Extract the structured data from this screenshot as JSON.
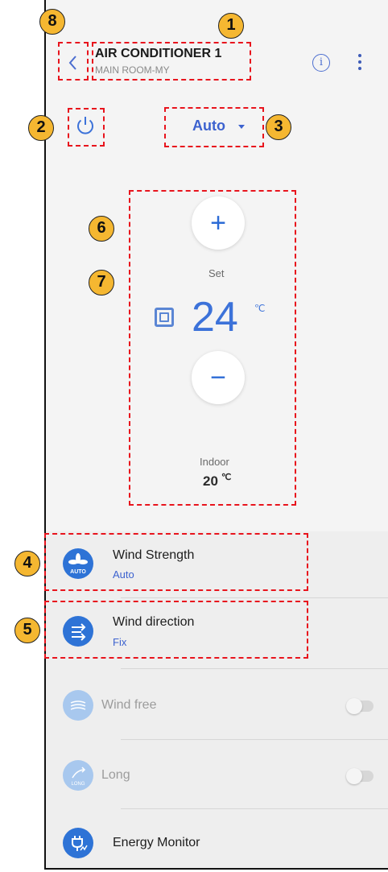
{
  "header": {
    "title": "AIR CONDITIONER 1",
    "subtitle": "MAIN ROOM-MY"
  },
  "mode": {
    "label": "Auto"
  },
  "temperature": {
    "set_label": "Set",
    "set_value": "24",
    "unit": "℃",
    "indoor_label": "Indoor",
    "indoor_value": "20"
  },
  "controls": {
    "plus_glyph": "+",
    "minus_glyph": "−"
  },
  "list": {
    "wind_strength": {
      "title": "Wind Strength",
      "value": "Auto",
      "icon_caption": "AUTO"
    },
    "wind_direction": {
      "title": "Wind direction",
      "value": "Fix"
    },
    "wind_free": {
      "title": "Wind free"
    },
    "long": {
      "title": "Long",
      "icon_caption": "LONG"
    },
    "energy_monitor": {
      "title": "Energy Monitor"
    }
  },
  "annotations": [
    "1",
    "2",
    "3",
    "4",
    "5",
    "6",
    "7",
    "8"
  ],
  "colors": {
    "accent": "#2e73d6",
    "highlight": "#e8141d",
    "badge": "#f5b731"
  }
}
